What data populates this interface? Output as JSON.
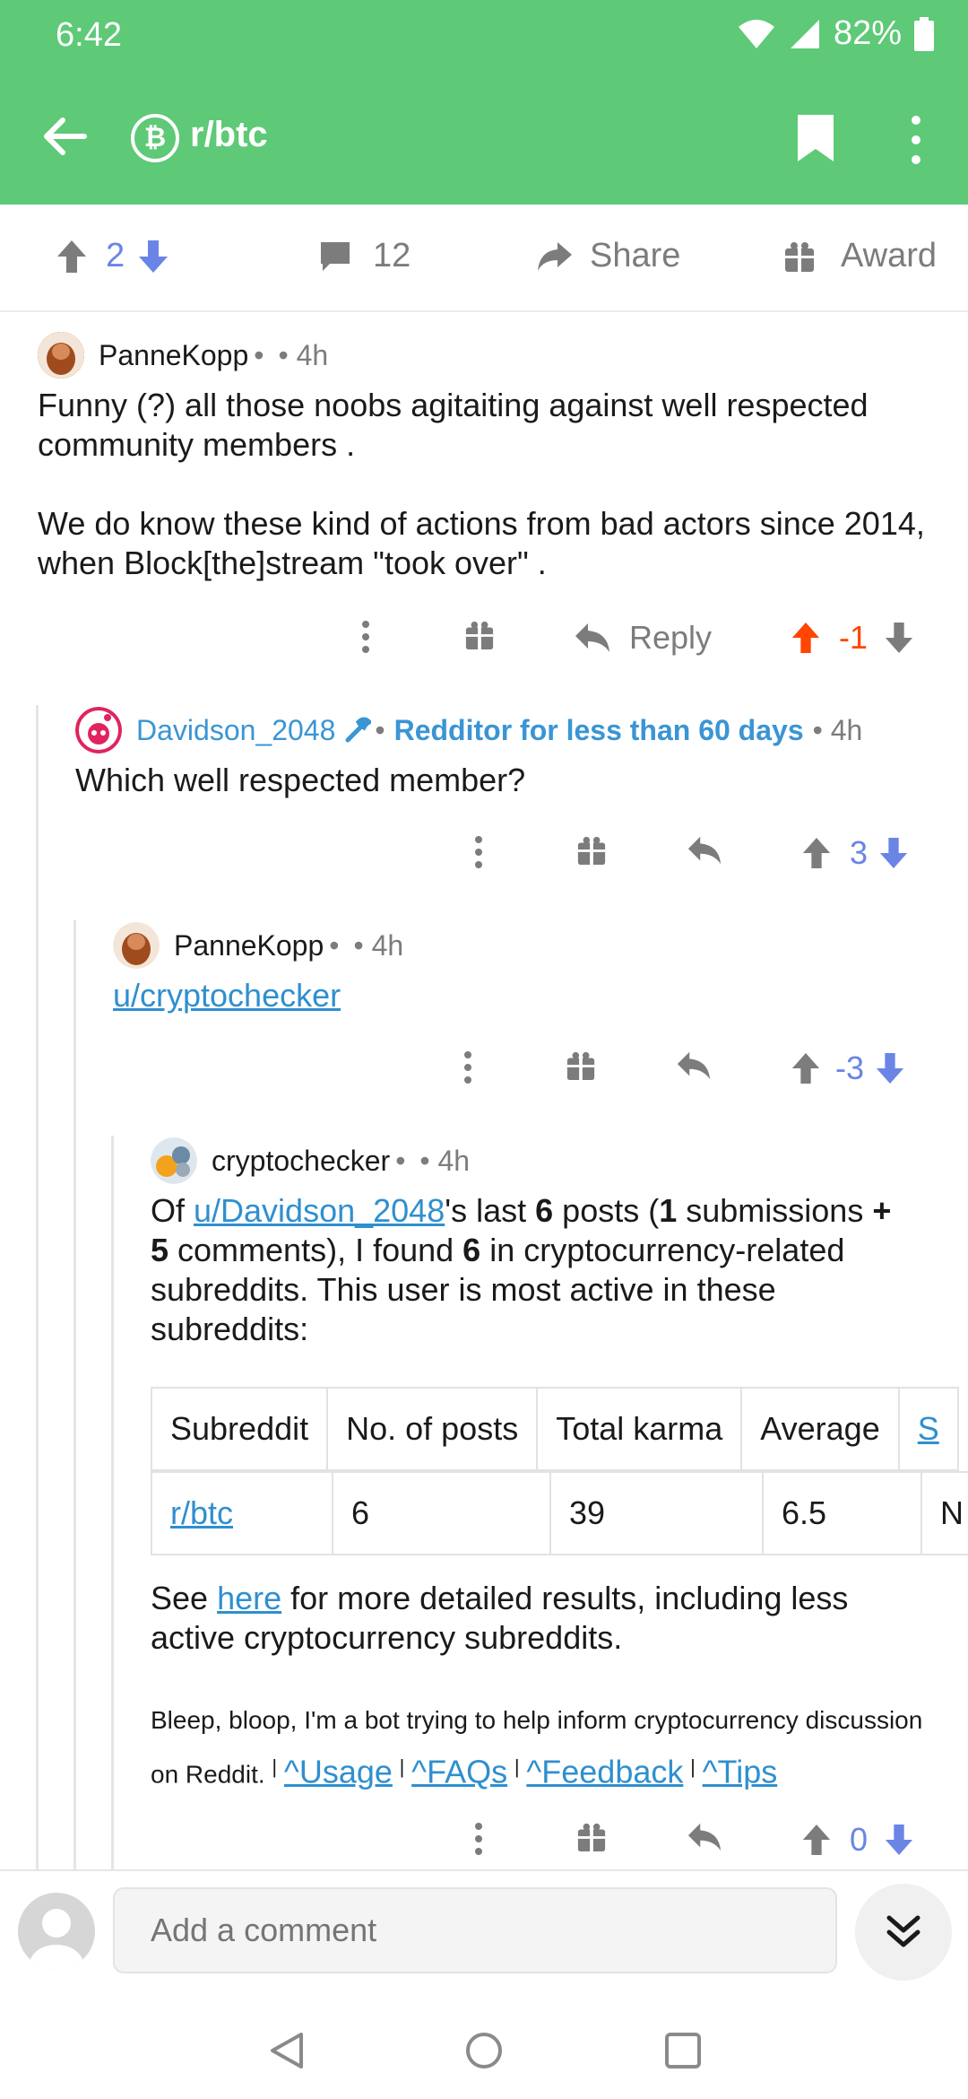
{
  "status": {
    "time": "6:42",
    "battery": "82%"
  },
  "toolbar": {
    "subreddit": "r/btc",
    "sub_icon_glyph": "₿"
  },
  "post_actions": {
    "score": "2",
    "comments": "12",
    "share": "Share",
    "award": "Award"
  },
  "comments": [
    {
      "author": "PanneKopp",
      "sep": "•",
      "time": "• 4h",
      "body_p1": "Funny (?) all those noobs agitaiting against well respected community members .",
      "body_p2": "We do know these kind of actions from bad actors since 2014, when Block[the]stream \"took over\" .",
      "reply": "Reply",
      "score": "-1"
    },
    {
      "author": "Davidson_2048",
      "flair": "Redditor for less than 60 days",
      "sep": "•",
      "time": "• 4h",
      "body": "Which well respected member?",
      "score": "3"
    },
    {
      "author": "PanneKopp",
      "sep": "•",
      "time": "• 4h",
      "link": "u/cryptochecker",
      "score": "-3"
    },
    {
      "author": "cryptochecker",
      "sep": "•",
      "time": "• 4h",
      "body_of": "Of ",
      "user_link": "u/Davidson_2048",
      "body_a": "'s last ",
      "n6": "6",
      "body_b": " posts (",
      "n1": "1",
      "body_c": " submissions ",
      "n5": "+ 5",
      "body_d": " comments), I found ",
      "n6b": "6",
      "body_e": " in cryptocurrency-related subreddits. This user is most active in these subreddits:",
      "table_headers": [
        "Subreddit",
        "No. of posts",
        "Total karma",
        "Average",
        "S"
      ],
      "table_row": [
        "r/btc",
        "6",
        "39",
        "6.5",
        "N"
      ],
      "see": "See ",
      "here": "here",
      "see_rest": " for more detailed results, including less active cryptocurrency subreddits.",
      "bot_text": "Bleep, bloop, I'm a bot trying to help inform cryptocurrency discussion on Reddit.",
      "pipe": "|",
      "links": [
        "^Usage",
        "^FAQs",
        "^Feedback",
        "^Tips"
      ],
      "score": "0"
    }
  ],
  "comment_bar": {
    "placeholder": "Add a comment"
  },
  "colors": {
    "header": "#5ec977",
    "upvote": "#ff4500",
    "link": "#2f8fcf",
    "vote_blue": "#6a85e6"
  }
}
